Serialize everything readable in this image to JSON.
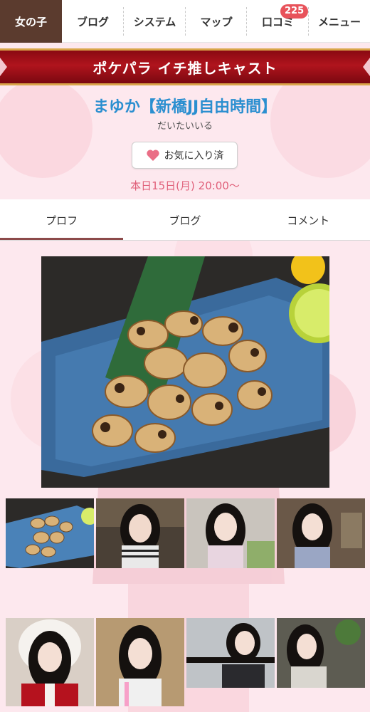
{
  "nav": {
    "items": [
      {
        "label": "女の子"
      },
      {
        "label": "ブログ"
      },
      {
        "label": "システム"
      },
      {
        "label": "マップ"
      },
      {
        "label": "口コミ",
        "badge": "225"
      },
      {
        "label": "メニュー"
      }
    ]
  },
  "banner": {
    "title": "ポケパラ イチ推しキャスト"
  },
  "cast": {
    "name": "まゆか【新橋JJ自由時間】",
    "subtitle": "だいたいいる",
    "favorite_label": "お気に入り済",
    "schedule": "本日15日(月) 20:00〜"
  },
  "tabs": [
    {
      "label": "プロフ",
      "active": true
    },
    {
      "label": "ブログ",
      "active": false
    },
    {
      "label": "コメント",
      "active": false
    }
  ],
  "photos": {
    "main": "food-photo",
    "thumbnails": [
      "food-photo",
      "portrait-photo",
      "portrait-photo",
      "portrait-photo",
      "santa-costume-photo",
      "portrait-photo",
      "portrait-photo",
      "portrait-photo"
    ]
  },
  "colors": {
    "nav_active": "#5b3b2e",
    "banner_red": "#b0141d",
    "name_blue": "#2b8fd0",
    "schedule_pink": "#e0607a",
    "badge_red": "#e8535b",
    "page_bg": "#fde8ee"
  }
}
